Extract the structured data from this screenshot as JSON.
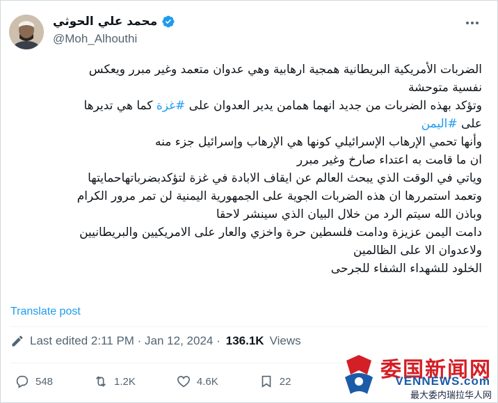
{
  "author": {
    "display_name": "محمد علي الحوثي",
    "handle": "@Moh_Alhouthi",
    "verified_icon": "verified-badge-icon",
    "badge_color": "#1d9bf0"
  },
  "post": {
    "lines": [
      {
        "text": "الضربات الأمريكية البريطانية همجية ارهابية وهي عدوان متعمد وغير مبرر ويعكس"
      },
      {
        "text": "نفسية متوحشة"
      },
      {
        "pre": "وتؤكد بهذه الضربات من جديد انهما همامن يدير العدوان على ",
        "tag": "#غزة",
        "post": " كما هي تديرها"
      },
      {
        "pre": "على ",
        "tag": "#اليمن",
        "post": ""
      },
      {
        "text": "وأنها تحمي الإرهاب الإسرائيلي كونها هي الإرهاب وإسرائيل جزء منه"
      },
      {
        "text": "ان ما قامت به اعتداء صارخ  وغير مبرر"
      },
      {
        "text": "وياتي في الوقت الذي يبحث العالم عن ايقاف الابادة في غزة لتؤكدبضرباتهاحمايتها"
      },
      {
        "text": "وتعمد استمررها ان هذه الضربات الجوية على الجمهورية اليمنية لن تمر مرور الكرام"
      },
      {
        "text": "وباذن الله سيتم الرد من خلال البيان الذي سينشر لاحقا"
      },
      {
        "text": "دامت اليمن عزيزة ودامت فلسطين حرة واخزي والعار على الامريكيين والبريطانيين"
      },
      {
        "text": "ولاعدوان الا على الظالمين"
      },
      {
        "text": "الخلود للشهداء الشفاء للجرحى"
      }
    ],
    "translate_label": "Translate post",
    "hashtag_color": "#1d9bf0"
  },
  "meta": {
    "edited_label": "Last edited 2:11 PM · Jan 12, 2024 ·",
    "views_count": "136.1K",
    "views_label": "Views"
  },
  "actions": {
    "replies": "548",
    "reposts": "1.2K",
    "likes": "4.6K",
    "bookmarks": "22"
  },
  "watermark": {
    "title": "委国新闻网",
    "site": "VENNEWS.com",
    "subtitle": "最大委内瑞拉华人网"
  }
}
